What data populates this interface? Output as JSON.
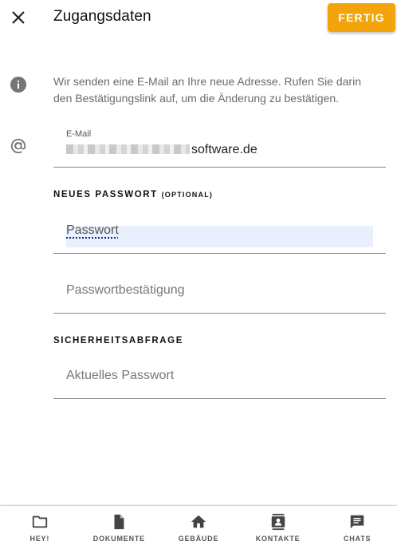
{
  "header": {
    "title": "Zugangsdaten",
    "done_label": "FERTIG"
  },
  "info": {
    "text": "Wir senden eine E-Mail an Ihre neue Adresse. Rufen Sie darin den Bestätigungslink auf, um die Änderung zu bestätigen."
  },
  "email": {
    "label": "E-Mail",
    "value_visible": "software.de"
  },
  "new_password": {
    "heading": "NEUES PASSWORT",
    "heading_note": "(OPTIONAL)",
    "password_placeholder": "Passwort",
    "confirm_placeholder": "Passwortbestätigung"
  },
  "security": {
    "heading": "SICHERHEITSABFRAGE",
    "current_placeholder": "Aktuelles Passwort"
  },
  "nav": {
    "items": [
      {
        "label": "HEY!",
        "icon": "folder-icon"
      },
      {
        "label": "DOKUMENTE",
        "icon": "document-icon"
      },
      {
        "label": "GEBÄUDE",
        "icon": "home-icon"
      },
      {
        "label": "KONTAKTE",
        "icon": "contacts-icon"
      },
      {
        "label": "CHATS",
        "icon": "chat-icon"
      }
    ]
  },
  "colors": {
    "accent": "#f4a40b",
    "highlight": "#e8f0fd"
  }
}
